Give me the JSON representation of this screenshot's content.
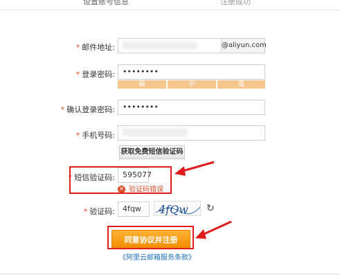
{
  "steps": [
    "设置账号信息",
    "注册成功"
  ],
  "form": {
    "email": {
      "label": "邮件地址:",
      "suffix": "@aliyun.com"
    },
    "password": {
      "label": "登录密码:",
      "value": "••••••••",
      "strength": [
        "弱",
        "中",
        "强"
      ]
    },
    "confirm_password": {
      "label": "确认登录密码:",
      "value": "••••••••"
    },
    "phone": {
      "label": "手机号码:"
    },
    "sms_button": "获取免费短信验证码",
    "sms_code": {
      "label": "短信验证码:",
      "value": "595077",
      "error_icon": "×",
      "error": "验证码错误"
    },
    "captcha": {
      "label": "验证码:",
      "value": "4fqw",
      "image_text": "4fQw",
      "refresh_icon": "↻"
    },
    "submit": "同意协议并注册",
    "terms": "《阿里云邮箱服务条款》",
    "required_mark": "*"
  },
  "colors": {
    "annotation": "#e01c1c",
    "submit": "#f39a10",
    "error": "#e04b2b",
    "strength": "#f5c78e"
  }
}
